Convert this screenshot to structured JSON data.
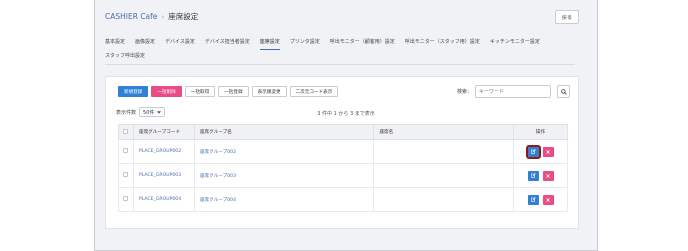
{
  "breadcrumb": {
    "home": "CASHIER Cafe",
    "current": "座席設定"
  },
  "back_label": "戻る",
  "tabs_row1": [
    "基本設定",
    "画像設定",
    "デバイス設定",
    "デバイス担当者設定",
    "座席設定",
    "プリンタ設定",
    "呼出モニター（顧客用）設定",
    "呼出モニター（スタッフ用）設定",
    "キッチンモニター設定"
  ],
  "tabs_row2": [
    "スタッフ呼出設定"
  ],
  "active_tab": "座席設定",
  "toolbar": {
    "new": "新規登録",
    "bulk_delete": "一括削除",
    "bulk_get": "一括取得",
    "bulk_register": "一括登録",
    "display_order": "表示順変更",
    "qr_display": "二次元コード表示"
  },
  "search": {
    "label": "検索：",
    "placeholder": "キーワード"
  },
  "page_size": {
    "label": "表示件数",
    "value": "50件"
  },
  "record_info": {
    "text": "3 件中 1 から 3 まで表示"
  },
  "table": {
    "headers": {
      "code": "座席グループコード",
      "group_name": "座席グループ名",
      "seat_name": "座席名",
      "ops": "操作"
    },
    "rows": [
      {
        "code": "PLACE_GROUP002",
        "group_name": "座席グループ002",
        "seat_name": ""
      },
      {
        "code": "PLACE_GROUP003",
        "group_name": "座席グループ003",
        "seat_name": ""
      },
      {
        "code": "PLACE_GROUP004",
        "group_name": "座席グループ004",
        "seat_name": ""
      }
    ]
  },
  "colors": {
    "primary": "#2f80d6",
    "danger": "#e94b86",
    "link": "#4a6ba8",
    "focus": "#8b1a1a"
  },
  "icons": {
    "search": "search-icon",
    "edit": "edit-icon",
    "delete": "close-icon",
    "dropdown": "chevron-down-icon",
    "breadcrumb_sep": "chevron-right-icon"
  }
}
